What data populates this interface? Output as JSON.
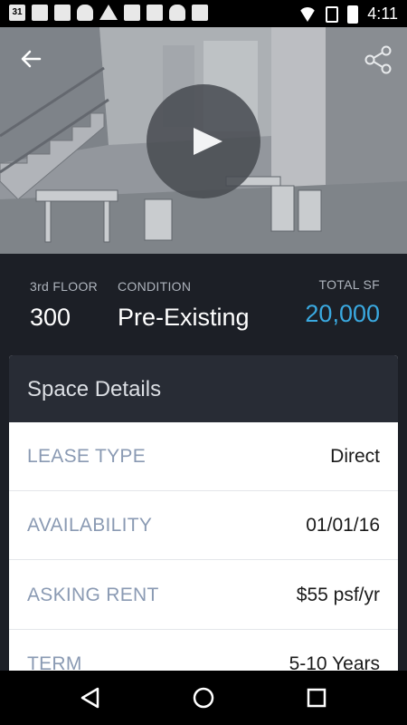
{
  "status_bar": {
    "time": "4:11",
    "icons": [
      "calendar-icon",
      "photos-icon",
      "gmail-icon",
      "android-icon",
      "drive-icon",
      "download-icon",
      "inbox-icon",
      "android-icon",
      "briefcase-icon",
      "wifi-icon",
      "no-sim-icon",
      "battery-icon"
    ],
    "calendar_day": "31"
  },
  "hero": {
    "back_icon": "arrow-back-icon",
    "share_icon": "share-icon",
    "play_icon": "play-icon"
  },
  "stats": {
    "floor_label": "3rd FLOOR",
    "floor_value": "300",
    "condition_label": "CONDITION",
    "condition_value": "Pre-Existing",
    "total_label": "TOTAL SF",
    "total_value": "20,000"
  },
  "space_details": {
    "title": "Space Details",
    "rows": [
      {
        "label": "LEASE TYPE",
        "value": "Direct"
      },
      {
        "label": "AVAILABILITY",
        "value": "01/01/16"
      },
      {
        "label": "ASKING RENT",
        "value": "$55 psf/yr"
      },
      {
        "label": "TERM",
        "value": "5-10 Years"
      }
    ]
  },
  "nav": {
    "back": "nav-back-icon",
    "home": "nav-home-icon",
    "recents": "nav-recents-icon"
  },
  "colors": {
    "background": "#1c1f26",
    "card_header": "#282c35",
    "accent": "#3aa9e0",
    "label": "#8a9ab3"
  }
}
